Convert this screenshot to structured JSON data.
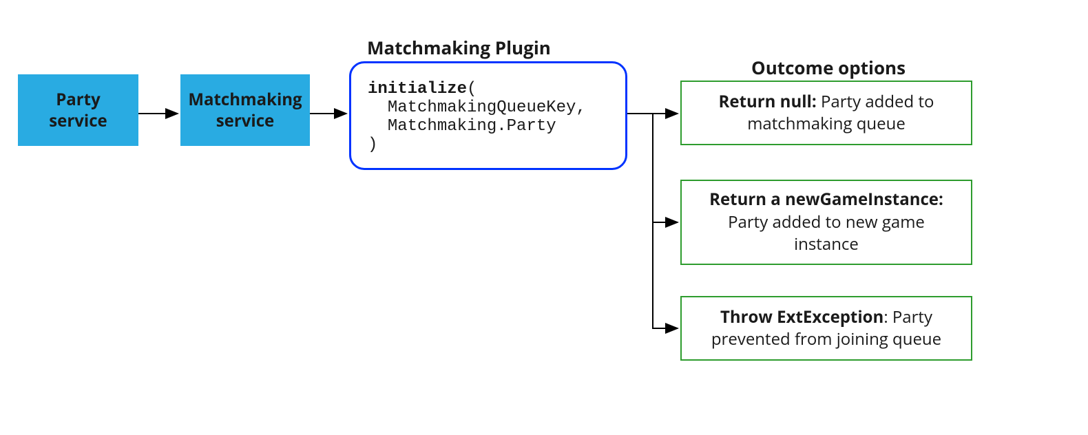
{
  "nodes": {
    "party": "Party\nservice",
    "mm": "Matchmaking\nservice",
    "pluginTitle": "Matchmaking Plugin",
    "plugin": {
      "fn": "initialize",
      "paren_open": "(",
      "arg1": "MatchmakingQueueKey,",
      "arg2": "Matchmaking.Party",
      "paren_close": ")"
    },
    "outcomeTitle": "Outcome options",
    "outcome1": {
      "bold": "Return null:",
      "text": " Party added to matchmaking queue"
    },
    "outcome2": {
      "bold": "Return a newGameInstance:",
      "text": " Party added to new game instance"
    },
    "outcome3": {
      "bold": "Throw ExtException",
      "text": ": Party prevented from joining queue"
    }
  },
  "colors": {
    "blue_fill": "#29abe2",
    "blue_border": "#0033ff",
    "green_border": "#2e9c2e",
    "arrow": "#000000"
  }
}
